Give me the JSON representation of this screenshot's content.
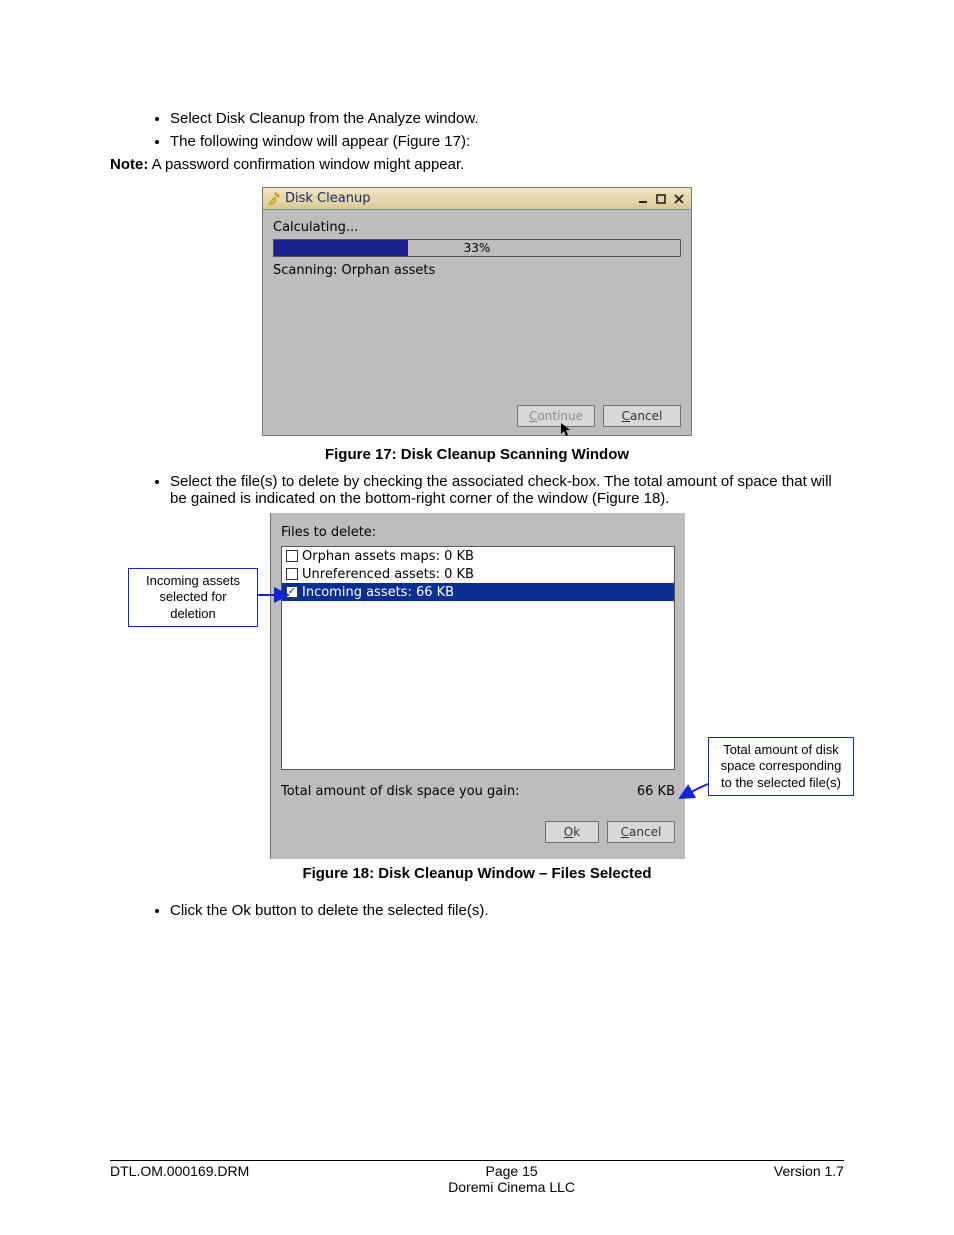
{
  "body": {
    "bullets_top": [
      "Select Disk Cleanup from the Analyze window.",
      "The following window will appear (Figure 17):"
    ],
    "note_label": "Note:",
    "note_text": " A password confirmation window might appear.",
    "bullets_mid": [
      "Select the file(s) to delete by checking the associated check-box. The total amount of space that will be gained is indicated on the bottom-right corner of the window (Figure 18)."
    ],
    "bullets_bottom": [
      "Click the Ok button to delete the selected file(s)."
    ]
  },
  "fig17": {
    "title": "Disk Cleanup",
    "calculating": "Calculating...",
    "progress_pct": 33,
    "progress_pct_label": "33%",
    "scanning": "Scanning: Orphan assets",
    "continue_prefix": "C",
    "continue_rest": "ontinue",
    "cancel_prefix": "C",
    "cancel_rest": "ancel",
    "caption": "Figure 17: Disk Cleanup Scanning Window"
  },
  "fig18": {
    "files_label": "Files to delete:",
    "rows": [
      {
        "label": "Orphan assets maps: 0 KB",
        "checked": false,
        "selected": false
      },
      {
        "label": "Unreferenced assets: 0 KB",
        "checked": false,
        "selected": false
      },
      {
        "label": "Incoming assets: 66 KB",
        "checked": true,
        "selected": true
      }
    ],
    "total_label": "Total amount of disk space you gain:",
    "total_value": "66 KB",
    "ok_prefix": "O",
    "ok_rest": "k",
    "cancel_prefix": "C",
    "cancel_rest": "ancel",
    "caption": "Figure 18: Disk Cleanup Window – Files Selected",
    "callout_left": "Incoming assets selected for deletion",
    "callout_right": "Total amount of disk space corresponding to the selected file(s)"
  },
  "footer": {
    "left": "DTL.OM.000169.DRM",
    "page": "Page 15",
    "company": "Doremi Cinema LLC",
    "right": "Version 1.7"
  }
}
